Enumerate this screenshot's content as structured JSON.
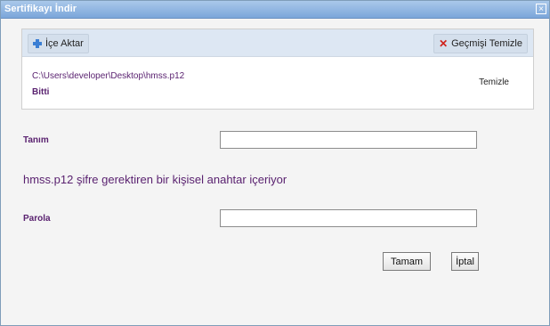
{
  "dialog": {
    "title": "Sertifikayı İndir",
    "close_glyph": "×"
  },
  "toolbar": {
    "import_label": "İçe Aktar",
    "clear_history_label": "Geçmişi Temizle"
  },
  "history": {
    "path": "C:\\Users\\developer\\Desktop\\hmss.p12",
    "status": "Bitti",
    "clear_label": "Temizle"
  },
  "form": {
    "description_label": "Tanım",
    "description_value": "",
    "message": "hmss.p12 şifre gerektiren bir kişisel anahtar içeriyor",
    "password_label": "Parola",
    "password_value": ""
  },
  "buttons": {
    "ok_label": "Tamam",
    "cancel_label": "İptal"
  },
  "colors": {
    "accent": "#5a2270",
    "titlebar": "#7ba6da",
    "toolbar": "#dde7f3",
    "close_red": "#d0201a",
    "plus_blue": "#3b7fd4"
  }
}
